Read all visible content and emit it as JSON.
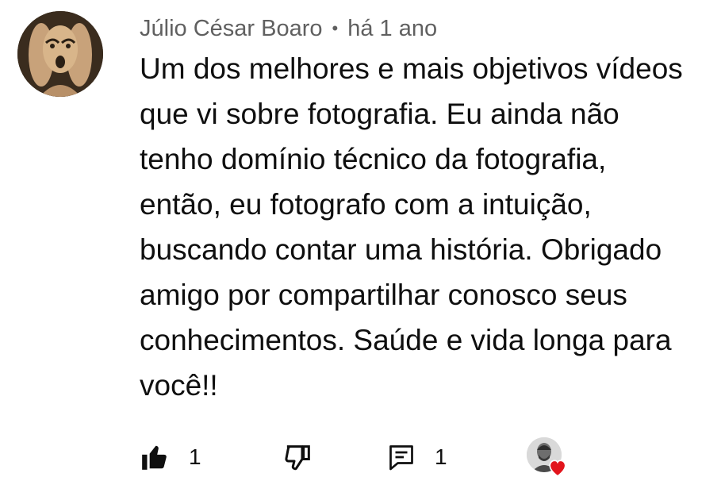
{
  "comment": {
    "author": "Júlio César Boaro",
    "separator": "•",
    "time": "há 1 ano",
    "text": "Um dos melhores e mais objetivos vídeos\nque vi sobre fotografia. Eu ainda não\ntenho domínio técnico da fotografia,\nentão, eu fotografo com a intuição,\nbuscando contar uma história. Obrigado\namigo por compartilhar conosco seus\nconhecimentos. Saúde e vida longa para\nvocê!!"
  },
  "actions": {
    "like_count": "1",
    "reply_count": "1"
  },
  "icons": {
    "like": "thumbs-up-icon",
    "dislike": "thumbs-down-icon",
    "reply": "comment-icon",
    "heart": "heart-icon"
  },
  "colors": {
    "heart": "#e2141c",
    "meta_text": "#606060",
    "body_text": "#0f0f0f"
  }
}
